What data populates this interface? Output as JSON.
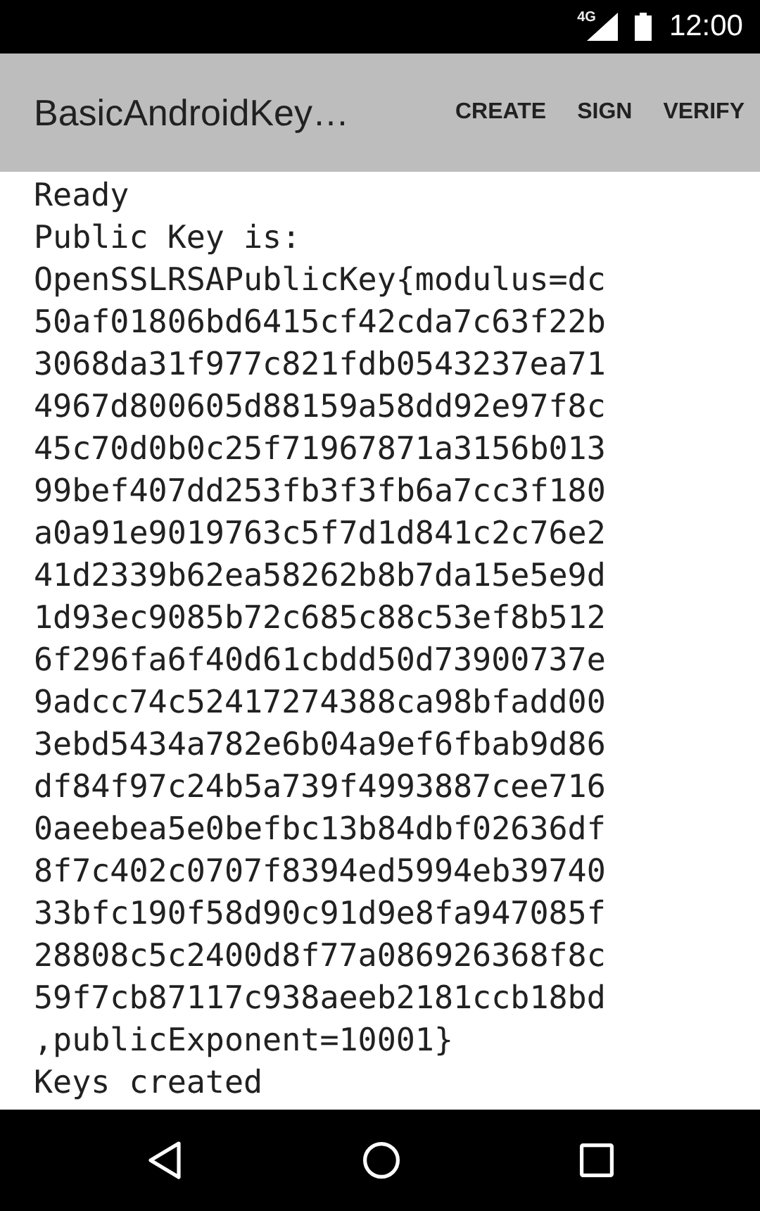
{
  "status_bar": {
    "network": "4G",
    "time": "12:00"
  },
  "app_bar": {
    "title": "BasicAndroidKey…",
    "actions": [
      "CREATE",
      "SIGN",
      "VERIFY"
    ]
  },
  "log_lines": [
    "Ready",
    "Public Key is:",
    "OpenSSLRSAPublicKey{modulus=dc",
    "50af01806bd6415cf42cda7c63f22b",
    "3068da31f977c821fdb0543237ea71",
    "4967d800605d88159a58dd92e97f8c",
    "45c70d0b0c25f71967871a3156b013",
    "99bef407dd253fb3f3fb6a7cc3f180",
    "a0a91e9019763c5f7d1d841c2c76e2",
    "41d2339b62ea58262b8b7da15e5e9d",
    "1d93ec9085b72c685c88c53ef8b512",
    "6f296fa6f40d61cbdd50d73900737e",
    "9adcc74c52417274388ca98bfadd00",
    "3ebd5434a782e6b04a9ef6fbab9d86",
    "df84f97c24b5a739f4993887cee716",
    "0aeebea5e0befbc13b84dbf02636df",
    "8f7c402c0707f8394ed5994eb39740",
    "33bfc190f58d90c91d9e8fa947085f",
    "28808c5c2400d8f77a086926368f8c",
    "59f7cb87117c938aeeb2181ccb18bd",
    ",publicExponent=10001}",
    "Keys created"
  ]
}
